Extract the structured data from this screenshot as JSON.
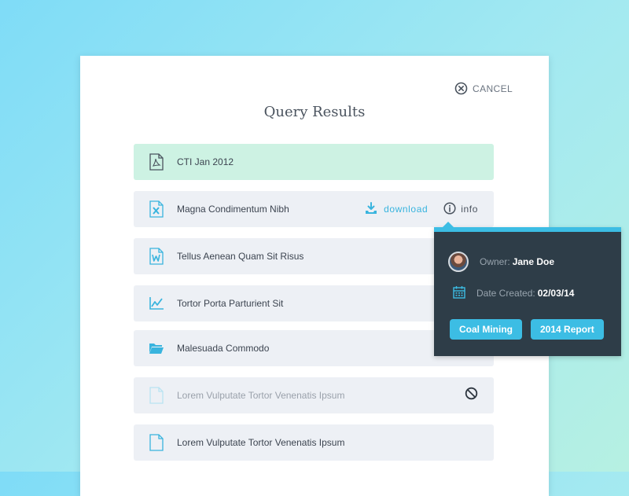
{
  "dialog": {
    "cancel_label": "CANCEL",
    "title": "Query Results"
  },
  "results": [
    {
      "name": "CTI Jan 2012",
      "icon": "pdf-file-icon",
      "state": "selected"
    },
    {
      "name": "Magna Condimentum Nibh",
      "icon": "excel-file-icon",
      "state": "hover",
      "download_label": "download",
      "info_label": "info"
    },
    {
      "name": "Tellus Aenean Quam Sit Risus",
      "icon": "word-file-icon",
      "state": "normal"
    },
    {
      "name": "Tortor Porta Parturient Sit",
      "icon": "chart-file-icon",
      "state": "normal"
    },
    {
      "name": "Malesuada Commodo",
      "icon": "folder-icon",
      "state": "normal"
    },
    {
      "name": "Lorem Vulputate Tortor Venenatis Ipsum",
      "icon": "blank-file-icon",
      "state": "disabled"
    },
    {
      "name": "Lorem Vulputate Tortor Venenatis Ipsum",
      "icon": "blank-file-icon",
      "state": "normal"
    }
  ],
  "info_popover": {
    "owner_label": "Owner:",
    "owner_value": "Jane Doe",
    "date_label": "Date Created:",
    "date_value": "02/03/14",
    "tags": [
      "Coal Mining",
      "2014 Report"
    ]
  },
  "colors": {
    "accent": "#3cbde4",
    "selected_row": "#cdf2e3",
    "row": "#edf0f5",
    "popover_bg": "#2e3d48"
  }
}
